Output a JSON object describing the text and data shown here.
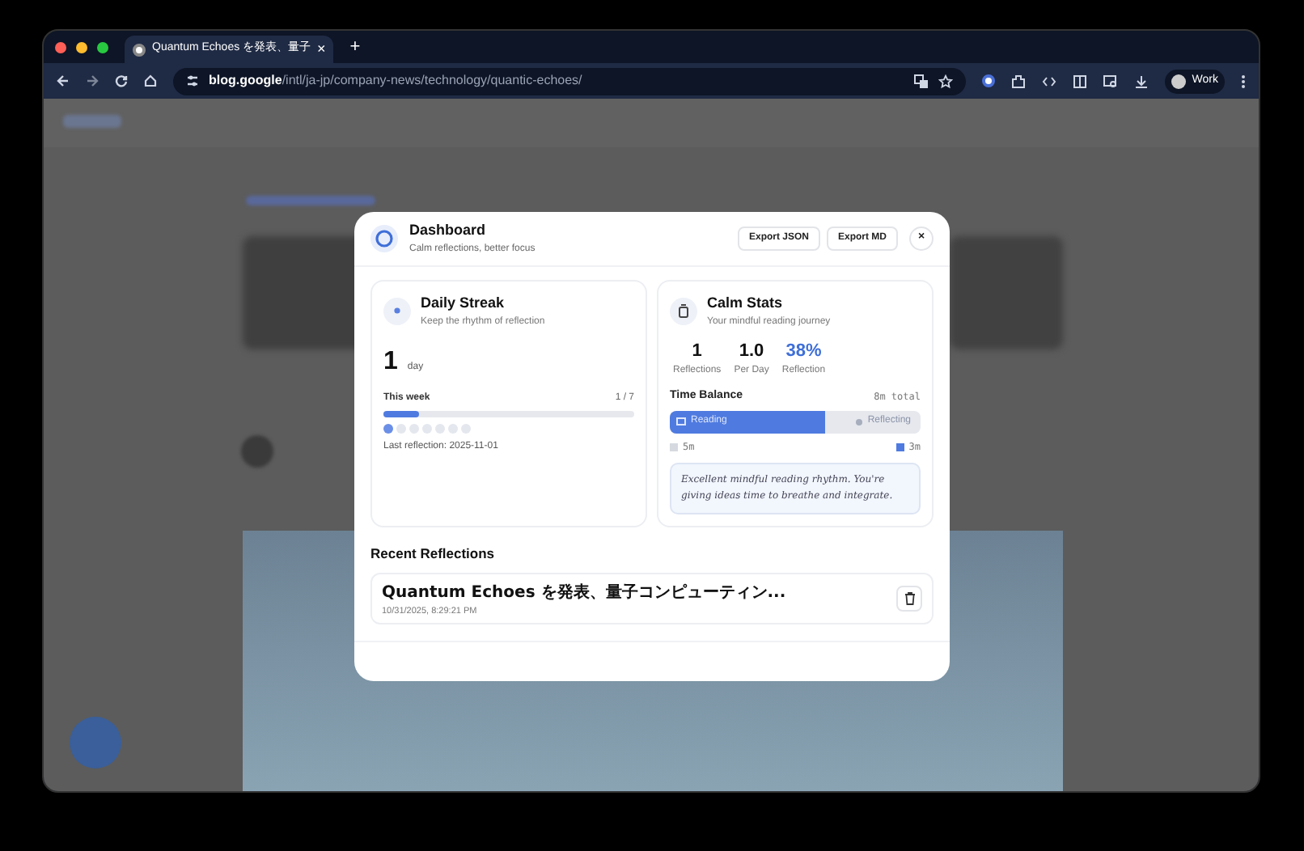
{
  "browser": {
    "tab_title": "Quantum Echoes を発表、量子",
    "tab_close": "×",
    "new_tab": "+",
    "url_host": "blog.google",
    "url_path": "/intl/ja-jp/company-news/technology/quantic-echoes/",
    "profile": "Work"
  },
  "dashboard": {
    "title": "Dashboard",
    "subtitle": "Calm reflections, better focus",
    "buttons": [
      "Export JSON",
      "Export MD"
    ],
    "close": "×"
  },
  "streak": {
    "title": "Daily Streak",
    "subtitle": "Keep the rhythm of reflection",
    "count": "1",
    "unit": "day",
    "week_label": "This week",
    "week_count": "1 / 7",
    "level": 0.14,
    "days": [
      {
        "done": true
      },
      {
        "done": false
      },
      {
        "done": false
      },
      {
        "done": false
      },
      {
        "done": false
      },
      {
        "done": false
      },
      {
        "done": false
      }
    ],
    "last": "Last reflection: 2025-11-01"
  },
  "stats": {
    "title": "Calm Stats",
    "subtitle": "Your mindful reading journey",
    "metrics": [
      {
        "value": "1",
        "label": "Reflections",
        "accent": false
      },
      {
        "value": "1.0",
        "label": "Per Day",
        "accent": false
      },
      {
        "value": "38%",
        "label": "Reflection",
        "accent": true
      }
    ],
    "balance_title": "Time Balance",
    "balance_total": "8m total",
    "reading_label": "Reading",
    "reflecting_label": "Reflecting",
    "level": 0.62,
    "legend_left": "5m",
    "legend_right": "3m",
    "note": "Excellent mindful reading rhythm. You're giving ideas time to breathe and integrate."
  },
  "recent": {
    "title": "Recent Reflections",
    "items": [
      {
        "title": "Quantum Echoes を発表、量子コンピューティン...",
        "time": "10/31/2025, 8:29:21 PM"
      }
    ]
  }
}
